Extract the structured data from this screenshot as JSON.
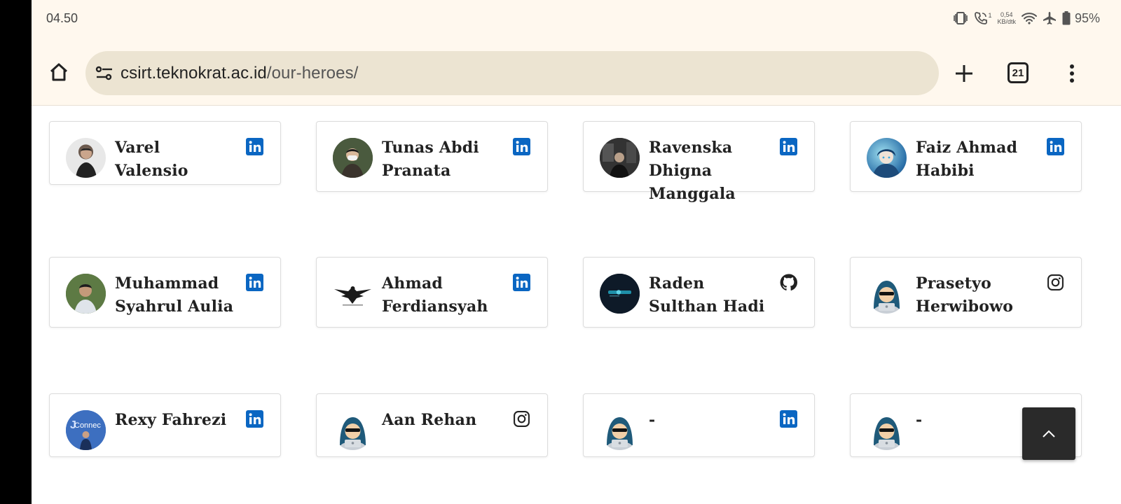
{
  "status_bar": {
    "time": "04.50",
    "call_count": "1",
    "speed_value": "0,54",
    "speed_unit": "KB/dtk",
    "battery": "95%"
  },
  "browser": {
    "url_host": "csirt.teknokrat.ac.id",
    "url_path": "/our-heroes/",
    "tab_count": "21"
  },
  "colors": {
    "linkedin": "#0a66c2",
    "page_bg": "#ffffff",
    "chrome_bg": "#fff8ee",
    "urlbar_bg": "#ece4d2"
  },
  "cards": [
    {
      "name": "Varel Valensio",
      "social": "linkedin-icon",
      "avatar": "photo"
    },
    {
      "name": "Tunas Abdi Pranata",
      "social": "linkedin-icon",
      "avatar": "photo"
    },
    {
      "name": "Ravenska Dhigna Manggala",
      "social": "linkedin-icon",
      "avatar": "photo"
    },
    {
      "name": "Faiz Ahmad Habibi",
      "social": "linkedin-icon",
      "avatar": "photo"
    },
    {
      "name": "Muhammad Syahrul Aulia",
      "social": "linkedin-icon",
      "avatar": "photo"
    },
    {
      "name": "Ahmad Ferdiansyah",
      "social": "linkedin-icon",
      "avatar": "eagle-logo"
    },
    {
      "name": "Raden Sulthan Hadi",
      "social": "github-icon",
      "avatar": "dark-logo"
    },
    {
      "name": "Prasetyo Herwibowo",
      "social": "instagram-icon",
      "avatar": "hacker"
    },
    {
      "name": "Rexy Fahrezi",
      "social": "linkedin-icon",
      "avatar": "photo"
    },
    {
      "name": "Aan Rehan",
      "social": "instagram-icon",
      "avatar": "hacker"
    },
    {
      "name": "-",
      "social": "linkedin-icon",
      "avatar": "hacker"
    },
    {
      "name": "-",
      "social": "none",
      "avatar": "hacker"
    }
  ]
}
